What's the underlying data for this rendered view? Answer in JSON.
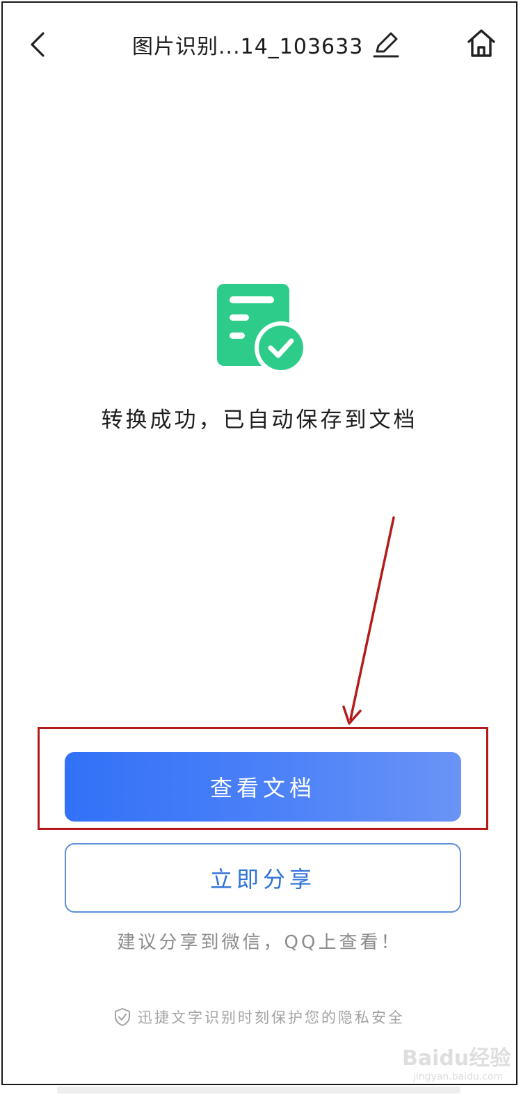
{
  "header": {
    "title": "图片识别...14_103633",
    "back_icon": "chevron-left-icon",
    "edit_icon": "pencil-icon",
    "home_icon": "home-icon"
  },
  "main": {
    "success_icon": "document-check-icon",
    "success_message": "转换成功，已自动保存到文档",
    "primary_button": "查看文档",
    "secondary_button": "立即分享",
    "hint": "建议分享到微信，QQ上查看！"
  },
  "footer": {
    "privacy_icon": "shield-icon",
    "privacy_text": "迅捷文字识别时刻保护您的隐私安全"
  },
  "watermark": {
    "brand": "Baidu经验",
    "url": "jingyan.baidu.com"
  },
  "colors": {
    "accent_green": "#2ecc8a",
    "primary_blue": "#3271f7",
    "secondary_blue": "#2f72d8",
    "annotation_red": "#b31b1b"
  }
}
